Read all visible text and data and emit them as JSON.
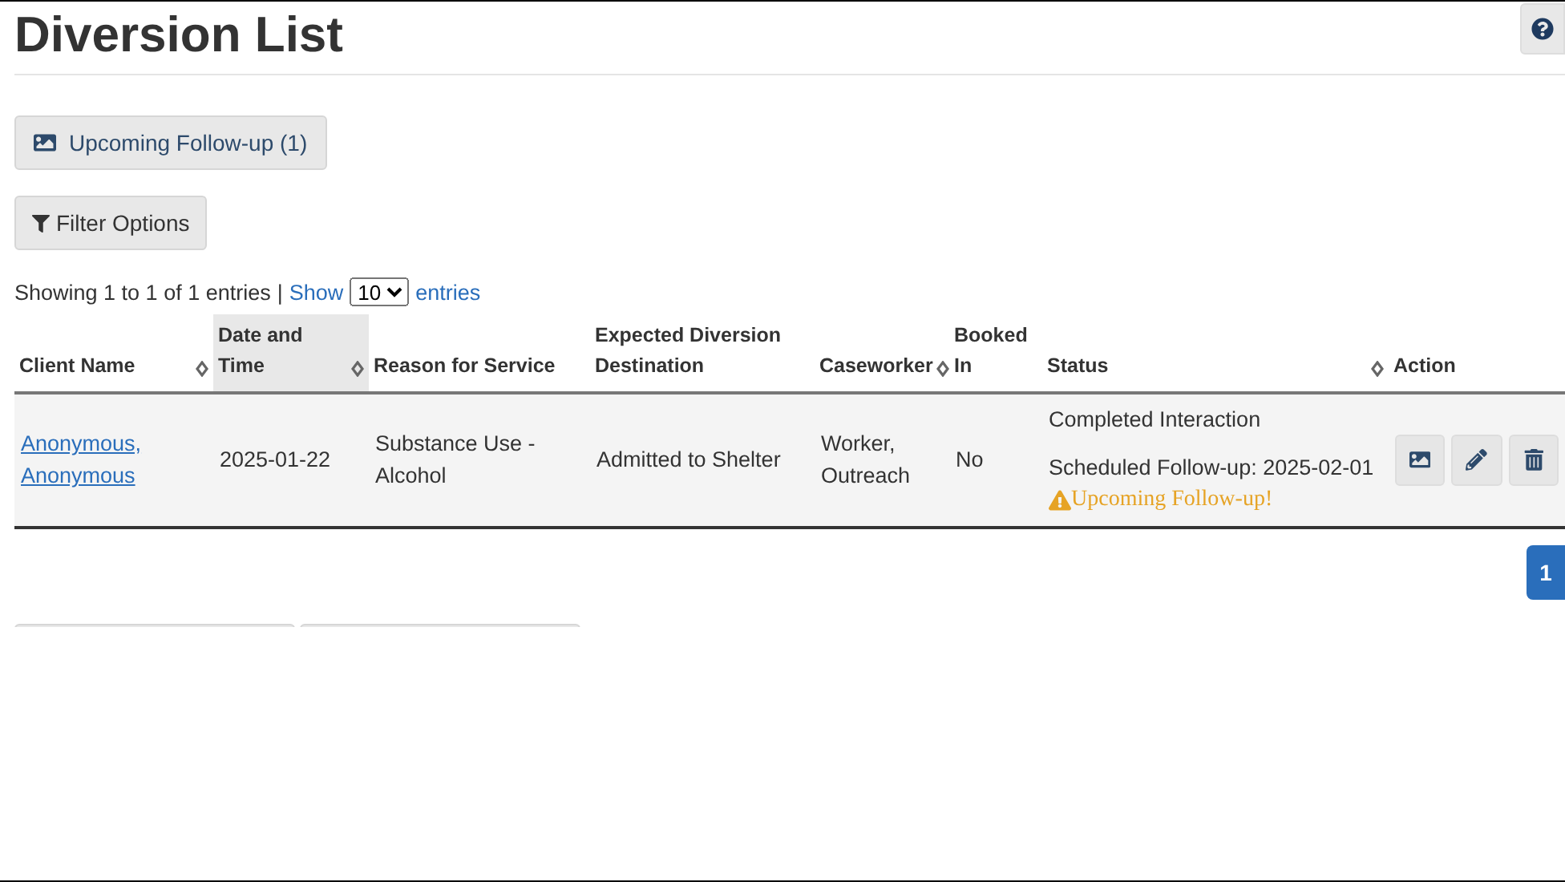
{
  "title": "Diversion List",
  "followup_button": {
    "label": "Upcoming Follow-up (1)"
  },
  "filter_button": {
    "label": "Filter Options"
  },
  "entries_info": {
    "showing": "Showing 1 to 1 of 1 entries",
    "separator": "|",
    "show": "Show",
    "page_size": "10",
    "entries": "entries"
  },
  "table": {
    "columns": [
      {
        "label": "Client Name",
        "sortable": true,
        "selected": false
      },
      {
        "label": "Date and Time",
        "sortable": true,
        "selected": true
      },
      {
        "label": "Reason for Service",
        "sortable": false,
        "selected": false
      },
      {
        "label": "Expected Diversion Destination",
        "sortable": false,
        "selected": false
      },
      {
        "label": "Caseworker",
        "sortable": true,
        "selected": false
      },
      {
        "label": "Booked In",
        "sortable": false,
        "selected": false
      },
      {
        "label": "Status",
        "sortable": true,
        "selected": false
      },
      {
        "label": "Action",
        "sortable": false,
        "selected": false
      }
    ],
    "rows": [
      {
        "client": "Anonymous, Anonymous",
        "date": "2025-01-22",
        "reason": "Substance Use - Alcohol",
        "destination": "Admitted to Shelter",
        "caseworker": "Worker, Outreach",
        "booked_in": "No",
        "status": "Completed Interaction",
        "followup": "Scheduled Follow-up: 2025-02-01",
        "warning": "Upcoming Follow-up!"
      }
    ]
  },
  "pagination": [
    {
      "label": "1",
      "selected": true
    }
  ]
}
